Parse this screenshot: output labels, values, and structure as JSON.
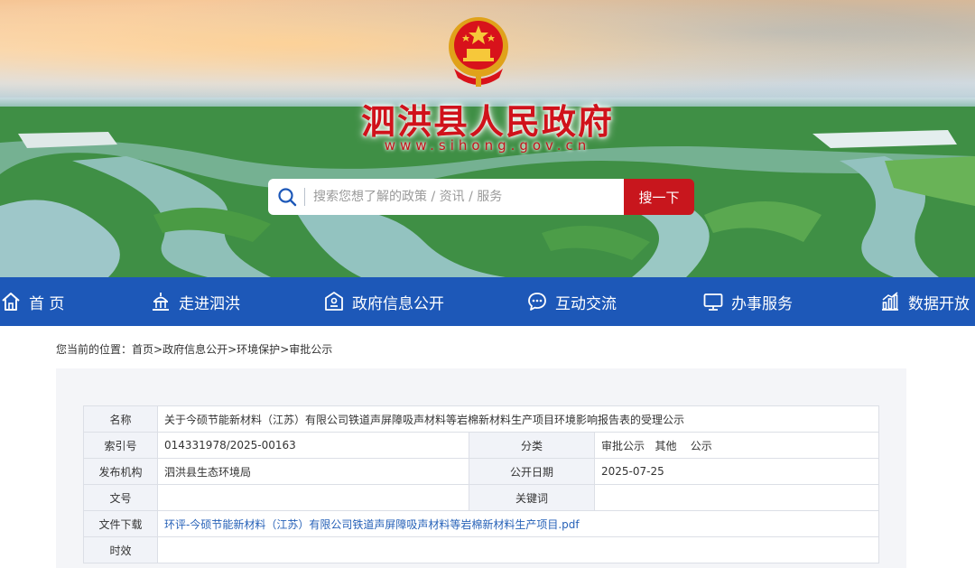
{
  "header": {
    "site_title": "泗洪县人民政府",
    "site_url": "www.sihong.gov.cn"
  },
  "search": {
    "placeholder": "搜索您想了解的政策 / 资讯 / 服务",
    "button_label": "搜一下"
  },
  "nav": {
    "items": [
      {
        "label": "首 页",
        "icon": "home-icon"
      },
      {
        "label": "走进泗洪",
        "icon": "landmark-icon"
      },
      {
        "label": "政府信息公开",
        "icon": "government-building-icon"
      },
      {
        "label": "互动交流",
        "icon": "chat-bubble-icon"
      },
      {
        "label": "办事服务",
        "icon": "monitor-icon"
      },
      {
        "label": "数据开放",
        "icon": "bar-chart-icon"
      }
    ]
  },
  "breadcrumb": {
    "prefix": "您当前的位置：",
    "items": [
      "首页",
      "政府信息公开",
      "环境保护",
      "审批公示"
    ],
    "separator": ">"
  },
  "info_table": {
    "name_label": "名称",
    "name_value": "关于今硕节能新材料（江苏）有限公司铁道声屏障吸声材料等岩棉新材料生产项目环境影响报告表的受理公示",
    "index_label": "索引号",
    "index_value": "014331978/2025-00163",
    "category_label": "分类",
    "category_value": "审批公示   其他    公示",
    "publisher_label": "发布机构",
    "publisher_value": "泗洪县生态环境局",
    "date_label": "公开日期",
    "date_value": "2025-07-25",
    "doc_no_label": "文号",
    "doc_no_value": "",
    "keywords_label": "关键词",
    "keywords_value": "",
    "download_label": "文件下载",
    "download_value": "环评-今硕节能新材料（江苏）有限公司铁道声屏障吸声材料等岩棉新材料生产项目.pdf",
    "validity_label": "时效",
    "validity_value": ""
  },
  "colors": {
    "nav_bg": "#1d58b8",
    "search_button": "#c8161d",
    "title_red": "#d0121b",
    "link_blue": "#2762b8"
  }
}
